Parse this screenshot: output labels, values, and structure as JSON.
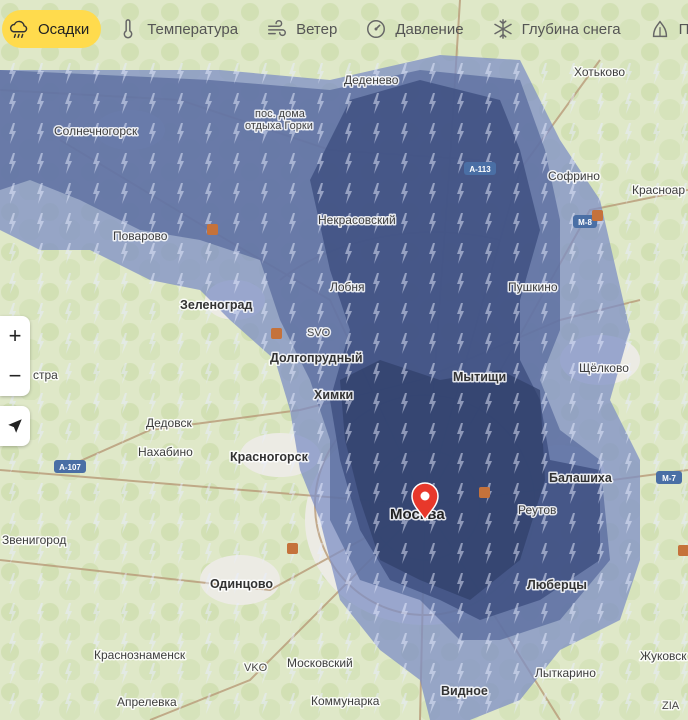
{
  "tabs": [
    {
      "label": "Осадки",
      "icon": "cloud-rain-icon",
      "active": true
    },
    {
      "label": "Температура",
      "icon": "thermometer-icon",
      "active": false
    },
    {
      "label": "Ветер",
      "icon": "wind-icon",
      "active": false
    },
    {
      "label": "Давление",
      "icon": "gauge-icon",
      "active": false
    },
    {
      "label": "Глубина снега",
      "icon": "snowflake-icon",
      "active": false
    },
    {
      "label": "Пыльца",
      "icon": "pollen-icon",
      "active": false
    }
  ],
  "controls": {
    "zoom_in": "+",
    "zoom_out": "−"
  },
  "places": [
    {
      "name": "Хотьково",
      "kind": "city"
    },
    {
      "name": "Деденево",
      "kind": "city"
    },
    {
      "name": "пос. дома",
      "kind": "small"
    },
    {
      "name": "отдыха Горки",
      "kind": "small"
    },
    {
      "name": "Солнечногорск",
      "kind": "city"
    },
    {
      "name": "Софрино",
      "kind": "city"
    },
    {
      "name": "Красноар",
      "kind": "city"
    },
    {
      "name": "Некрасовский",
      "kind": "city"
    },
    {
      "name": "Поварово",
      "kind": "city"
    },
    {
      "name": "Пушкино",
      "kind": "city"
    },
    {
      "name": "Лобня",
      "kind": "city"
    },
    {
      "name": "Зеленоград",
      "kind": "town"
    },
    {
      "name": "SVO",
      "kind": "small"
    },
    {
      "name": "Долгопрудный",
      "kind": "town"
    },
    {
      "name": "стра",
      "kind": "city"
    },
    {
      "name": "Мытищи",
      "kind": "town"
    },
    {
      "name": "Щёлково",
      "kind": "city"
    },
    {
      "name": "Химки",
      "kind": "town"
    },
    {
      "name": "Дедовск",
      "kind": "city"
    },
    {
      "name": "Нахабино",
      "kind": "city"
    },
    {
      "name": "Красногорск",
      "kind": "town"
    },
    {
      "name": "Балашиха",
      "kind": "town"
    },
    {
      "name": "Москва",
      "kind": "capital"
    },
    {
      "name": "Реутов",
      "kind": "city"
    },
    {
      "name": "Звенигород",
      "kind": "city"
    },
    {
      "name": "Одинцово",
      "kind": "town"
    },
    {
      "name": "Люберцы",
      "kind": "town"
    },
    {
      "name": "Краснознаменск",
      "kind": "city"
    },
    {
      "name": "VKO",
      "kind": "small"
    },
    {
      "name": "Московский",
      "kind": "city"
    },
    {
      "name": "Лыткарино",
      "kind": "city"
    },
    {
      "name": "Жуковск",
      "kind": "city"
    },
    {
      "name": "Видное",
      "kind": "town"
    },
    {
      "name": "Апрелевка",
      "kind": "city"
    },
    {
      "name": "Коммунарка",
      "kind": "city"
    },
    {
      "name": "ZIA",
      "kind": "small"
    }
  ],
  "highways": [
    "А-113",
    "М-8",
    "А-107",
    "М-7"
  ],
  "colors": {
    "primary_tab": "#ffdb4d",
    "rain_light": "#7d8fc4",
    "rain_heavy": "#34466f",
    "marker": "#e8382b"
  }
}
